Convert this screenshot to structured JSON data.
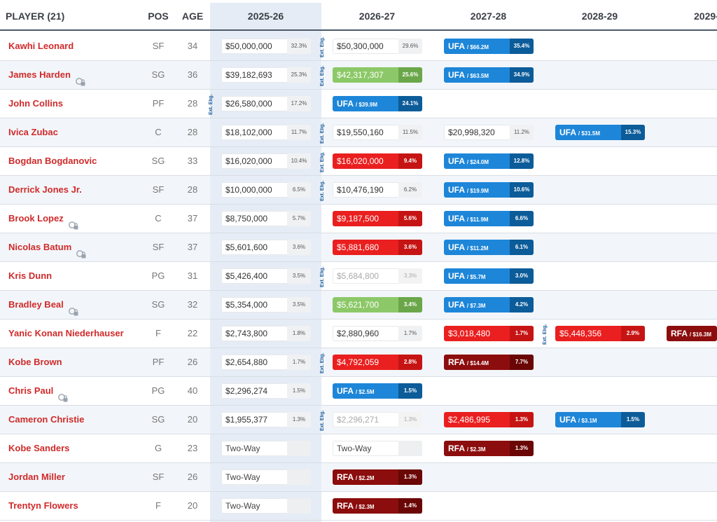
{
  "header": {
    "player_label": "PLAYER (21)",
    "pos_label": "POS",
    "age_label": "AGE",
    "years": [
      "2025-26",
      "2026-27",
      "2027-28",
      "2028-29",
      "2029-"
    ]
  },
  "ext_label": "Ext. Elig.",
  "colors": {
    "player_name": "#d02a2a",
    "guaranteed": "#ffffff",
    "player_option": "#8cc868",
    "team_option": "#ea1f1f",
    "ufa": "#1d86d8",
    "rfa": "#8c0d0d",
    "current_season_bg": "#e6ecf5"
  },
  "players": [
    {
      "name": "Kawhi Leonard",
      "pos": "SF",
      "age": "34",
      "option_icon": false,
      "ext": [
        1
      ],
      "cells": [
        {
          "type": "guar",
          "amount": "$50,000,000",
          "pct": "32.3%"
        },
        {
          "type": "guar",
          "amount": "$50,300,000",
          "pct": "29.6%"
        },
        {
          "type": "ufa",
          "status": "UFA",
          "cap": "/ $66.2M",
          "pct": "35.4%"
        }
      ]
    },
    {
      "name": "James Harden",
      "pos": "SG",
      "age": "36",
      "option_icon": true,
      "ext": [
        1
      ],
      "cells": [
        {
          "type": "guar",
          "amount": "$39,182,693",
          "pct": "25.3%"
        },
        {
          "type": "player",
          "amount": "$42,317,307",
          "pct": "25.6%"
        },
        {
          "type": "ufa",
          "status": "UFA",
          "cap": "/ $63.5M",
          "pct": "34.9%"
        }
      ]
    },
    {
      "name": "John Collins",
      "pos": "PF",
      "age": "28",
      "option_icon": false,
      "ext": [
        0
      ],
      "cells": [
        {
          "type": "guar",
          "amount": "$26,580,000",
          "pct": "17.2%"
        },
        {
          "type": "ufa",
          "status": "UFA",
          "cap": "/ $39.9M",
          "pct": "24.1%"
        }
      ]
    },
    {
      "name": "Ivica Zubac",
      "pos": "C",
      "age": "28",
      "option_icon": false,
      "ext": [
        1
      ],
      "cells": [
        {
          "type": "guar",
          "amount": "$18,102,000",
          "pct": "11.7%"
        },
        {
          "type": "guar",
          "amount": "$19,550,160",
          "pct": "11.5%"
        },
        {
          "type": "guar",
          "amount": "$20,998,320",
          "pct": "11.2%"
        },
        {
          "type": "ufa",
          "status": "UFA",
          "cap": "/ $31.5M",
          "pct": "15.3%"
        }
      ]
    },
    {
      "name": "Bogdan Bogdanovic",
      "pos": "SG",
      "age": "33",
      "option_icon": false,
      "ext": [
        1
      ],
      "cells": [
        {
          "type": "guar",
          "amount": "$16,020,000",
          "pct": "10.4%"
        },
        {
          "type": "team",
          "amount": "$16,020,000",
          "pct": "9.4%"
        },
        {
          "type": "ufa",
          "status": "UFA",
          "cap": "/ $24.0M",
          "pct": "12.8%"
        }
      ]
    },
    {
      "name": "Derrick Jones Jr.",
      "pos": "SF",
      "age": "28",
      "option_icon": false,
      "ext": [
        1
      ],
      "cells": [
        {
          "type": "guar",
          "amount": "$10,000,000",
          "pct": "6.5%"
        },
        {
          "type": "guar",
          "amount": "$10,476,190",
          "pct": "6.2%"
        },
        {
          "type": "ufa",
          "status": "UFA",
          "cap": "/ $19.9M",
          "pct": "10.6%"
        }
      ]
    },
    {
      "name": "Brook Lopez",
      "pos": "C",
      "age": "37",
      "option_icon": true,
      "ext": [],
      "cells": [
        {
          "type": "guar",
          "amount": "$8,750,000",
          "pct": "5.7%"
        },
        {
          "type": "team",
          "amount": "$9,187,500",
          "pct": "5.6%"
        },
        {
          "type": "ufa",
          "status": "UFA",
          "cap": "/ $11.9M",
          "pct": "6.6%"
        }
      ]
    },
    {
      "name": "Nicolas Batum",
      "pos": "SF",
      "age": "37",
      "option_icon": true,
      "ext": [],
      "cells": [
        {
          "type": "guar",
          "amount": "$5,601,600",
          "pct": "3.6%"
        },
        {
          "type": "team",
          "amount": "$5,881,680",
          "pct": "3.6%"
        },
        {
          "type": "ufa",
          "status": "UFA",
          "cap": "/ $11.2M",
          "pct": "6.1%"
        }
      ]
    },
    {
      "name": "Kris Dunn",
      "pos": "PG",
      "age": "31",
      "option_icon": false,
      "ext": [
        1
      ],
      "cells": [
        {
          "type": "guar",
          "amount": "$5,426,400",
          "pct": "3.5%"
        },
        {
          "type": "proj",
          "amount": "$5,684,800",
          "pct": "3.3%"
        },
        {
          "type": "ufa",
          "status": "UFA",
          "cap": "/ $5.7M",
          "pct": "3.0%"
        }
      ]
    },
    {
      "name": "Bradley Beal",
      "pos": "SG",
      "age": "32",
      "option_icon": true,
      "ext": [],
      "cells": [
        {
          "type": "guar",
          "amount": "$5,354,000",
          "pct": "3.5%"
        },
        {
          "type": "player",
          "amount": "$5,621,700",
          "pct": "3.4%"
        },
        {
          "type": "ufa",
          "status": "UFA",
          "cap": "/ $7.3M",
          "pct": "4.2%"
        }
      ]
    },
    {
      "name": "Yanic Konan Niederhauser",
      "pos": "F",
      "age": "22",
      "option_icon": false,
      "ext": [
        3
      ],
      "cells": [
        {
          "type": "guar",
          "amount": "$2,743,800",
          "pct": "1.8%"
        },
        {
          "type": "guar",
          "amount": "$2,880,960",
          "pct": "1.7%"
        },
        {
          "type": "team",
          "amount": "$3,018,480",
          "pct": "1.7%"
        },
        {
          "type": "team",
          "amount": "$5,448,356",
          "pct": "2.9%"
        },
        {
          "type": "rfa",
          "status": "RFA",
          "cap": "/ $16.3M",
          "pct": ""
        }
      ]
    },
    {
      "name": "Kobe Brown",
      "pos": "PF",
      "age": "26",
      "option_icon": false,
      "ext": [
        1
      ],
      "cells": [
        {
          "type": "guar",
          "amount": "$2,654,880",
          "pct": "1.7%"
        },
        {
          "type": "team",
          "amount": "$4,792,059",
          "pct": "2.8%"
        },
        {
          "type": "rfa",
          "status": "RFA",
          "cap": "/ $14.4M",
          "pct": "7.7%"
        }
      ]
    },
    {
      "name": "Chris Paul",
      "pos": "PG",
      "age": "40",
      "option_icon": true,
      "ext": [],
      "cells": [
        {
          "type": "guar",
          "amount": "$2,296,274",
          "pct": "1.5%"
        },
        {
          "type": "ufa",
          "status": "UFA",
          "cap": "/ $2.5M",
          "pct": "1.5%"
        }
      ]
    },
    {
      "name": "Cameron Christie",
      "pos": "SG",
      "age": "20",
      "option_icon": false,
      "ext": [
        1
      ],
      "cells": [
        {
          "type": "guar",
          "amount": "$1,955,377",
          "pct": "1.3%"
        },
        {
          "type": "proj",
          "amount": "$2,296,271",
          "pct": "1.3%"
        },
        {
          "type": "team",
          "amount": "$2,486,995",
          "pct": "1.3%"
        },
        {
          "type": "ufa",
          "status": "UFA",
          "cap": "/ $3.1M",
          "pct": "1.5%"
        }
      ]
    },
    {
      "name": "Kobe Sanders",
      "pos": "G",
      "age": "23",
      "option_icon": false,
      "ext": [],
      "cells": [
        {
          "type": "twoway",
          "amount": "Two-Way",
          "pct": ""
        },
        {
          "type": "twoway",
          "amount": "Two-Way",
          "pct": ""
        },
        {
          "type": "rfa",
          "status": "RFA",
          "cap": "/ $2.3M",
          "pct": "1.3%"
        }
      ]
    },
    {
      "name": "Jordan Miller",
      "pos": "SF",
      "age": "26",
      "option_icon": false,
      "ext": [],
      "cells": [
        {
          "type": "twoway",
          "amount": "Two-Way",
          "pct": ""
        },
        {
          "type": "rfa",
          "status": "RFA",
          "cap": "/ $2.2M",
          "pct": "1.3%"
        }
      ]
    },
    {
      "name": "Trentyn Flowers",
      "pos": "F",
      "age": "20",
      "option_icon": false,
      "ext": [],
      "cells": [
        {
          "type": "twoway",
          "amount": "Two-Way",
          "pct": ""
        },
        {
          "type": "rfa",
          "status": "RFA",
          "cap": "/ $2.3M",
          "pct": "1.4%"
        }
      ]
    }
  ]
}
